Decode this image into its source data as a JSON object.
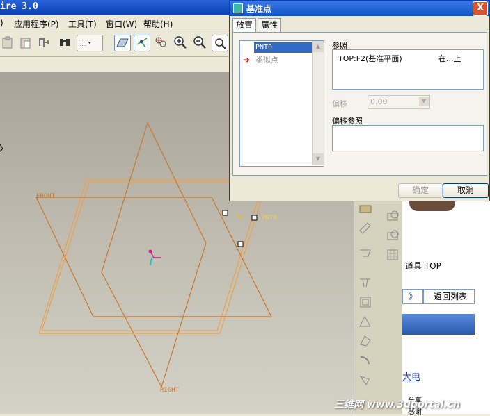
{
  "window": {
    "title": "ire 3.0"
  },
  "menu": [
    {
      "label": ")"
    },
    {
      "label": "应用程序(P)"
    },
    {
      "label": "工具(T)"
    },
    {
      "label": "窗口(W)"
    },
    {
      "label": "帮助(H)"
    }
  ],
  "toolbar": {
    "icons": [
      "paste-icon",
      "paste-special-icon",
      "regenerate-icon",
      "find-icon",
      "select-box-icon",
      "datum-plane-icon",
      "datum-axis-icon",
      "datum-point-icon",
      "zoom-in-icon",
      "zoom-out-icon",
      "refit-icon"
    ]
  },
  "graphics": {
    "label_front": "FRONT",
    "label_right": "RIGHT",
    "label_point": "PNT0",
    "colors": {
      "plane": "#c47830",
      "highlight": "#e8a050"
    }
  },
  "dialog": {
    "title": "基准点",
    "close": "X",
    "tabs": [
      "放置",
      "属性"
    ],
    "points": [
      "PNT0",
      "类似点"
    ],
    "ref_label": "参照",
    "ref_row": {
      "name": "TOP:F2(基准平面)",
      "type": "在...上"
    },
    "offset_label": "偏移",
    "offset_value": "0.00",
    "offset_ref_label": "偏移参照",
    "ok": "确定",
    "cancel": "取消"
  },
  "web": {
    "nav_text": "道具  TOP",
    "more": "》",
    "back": "返回列表",
    "link": "大电",
    "bottom1": "分享",
    "bottom2": "感谢",
    "watermark": "三维网 www.3dportal.cn"
  }
}
